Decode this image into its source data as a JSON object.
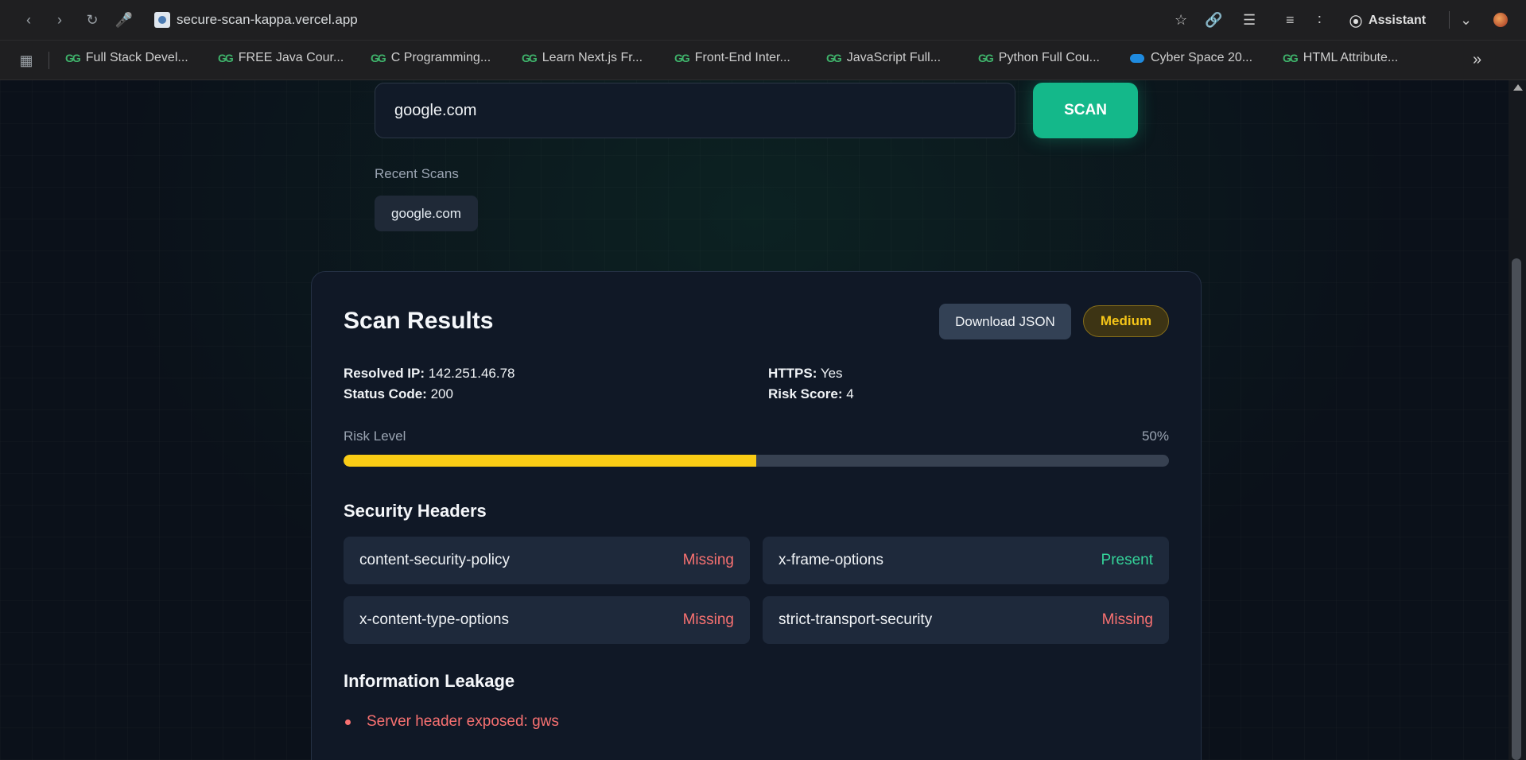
{
  "browser": {
    "url": "secure-scan-kappa.vercel.app",
    "assistant_label": "Assistant",
    "bookmarks": [
      {
        "label": "Full Stack Devel..."
      },
      {
        "label": "FREE Java Cour..."
      },
      {
        "label": "C Programming..."
      },
      {
        "label": "Learn Next.js Fr..."
      },
      {
        "label": "Front-End Inter..."
      },
      {
        "label": "JavaScript Full..."
      },
      {
        "label": "Python Full Cou..."
      },
      {
        "label": "Cyber Space 20..."
      },
      {
        "label": "HTML Attribute..."
      }
    ]
  },
  "search": {
    "value": "google.com",
    "button_label": "SCAN"
  },
  "recent": {
    "label": "Recent Scans",
    "items": [
      "google.com"
    ]
  },
  "results": {
    "title": "Scan Results",
    "download_label": "Download JSON",
    "risk_badge": "Medium",
    "resolved_ip_label": "Resolved IP:",
    "resolved_ip": "142.251.46.78",
    "status_code_label": "Status Code:",
    "status_code": "200",
    "https_label": "HTTPS:",
    "https": "Yes",
    "risk_score_label": "Risk Score:",
    "risk_score": "4",
    "risk_level_label": "Risk Level",
    "risk_level_text": "50%",
    "risk_level_fraction": 0.5,
    "headers_title": "Security Headers",
    "headers": [
      {
        "name": "content-security-policy",
        "status": "Missing"
      },
      {
        "name": "x-frame-options",
        "status": "Present"
      },
      {
        "name": "x-content-type-options",
        "status": "Missing"
      },
      {
        "name": "strict-transport-security",
        "status": "Missing"
      }
    ],
    "leakage_title": "Information Leakage",
    "leakage": [
      "Server header exposed: gws"
    ]
  },
  "colors": {
    "accent": "#14b88a",
    "missing": "#f87171",
    "present": "#34d399",
    "warning": "#facc15"
  }
}
